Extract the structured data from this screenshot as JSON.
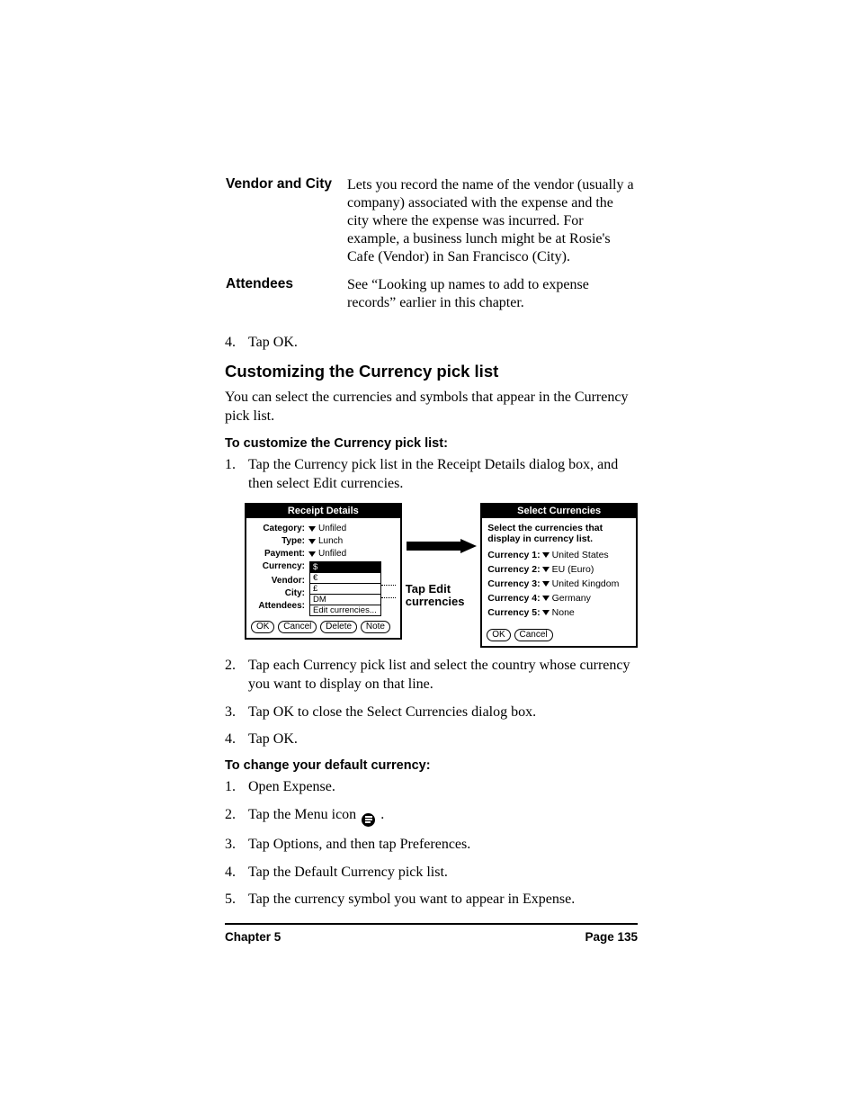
{
  "definitions": [
    {
      "term": "Vendor and City",
      "desc": "Lets you record the name of the vendor (usually a company) associated with the expense and the city where the expense was incurred. For example, a business lunch might be at Rosie's Cafe (Vendor) in San Francisco (City)."
    },
    {
      "term": "Attendees",
      "desc": "See “Looking up names to add to expense records” earlier in this chapter."
    }
  ],
  "pre_step": {
    "n": "4.",
    "t": "Tap OK."
  },
  "section_heading": "Customizing the Currency pick list",
  "section_intro": "You can select the currencies and symbols that appear in the Currency pick list.",
  "proc1_title": "To customize the Currency pick list:",
  "proc1_steps": [
    {
      "n": "1.",
      "t": "Tap the Currency pick list in the Receipt Details dialog box, and then select Edit currencies."
    },
    {
      "n": "2.",
      "t": "Tap each Currency pick list and select the country whose currency you want to display on that line."
    },
    {
      "n": "3.",
      "t": "Tap OK to close the Select Currencies dialog box."
    },
    {
      "n": "4.",
      "t": "Tap OK."
    }
  ],
  "proc2_title": "To change your default currency:",
  "proc2_steps": [
    {
      "n": "1.",
      "t": "Open Expense."
    },
    {
      "n": "2.",
      "t_pre": "Tap the Menu icon ",
      "t_post": " ."
    },
    {
      "n": "3.",
      "t": "Tap Options, and then tap Preferences."
    },
    {
      "n": "4.",
      "t": "Tap the Default Currency pick list."
    },
    {
      "n": "5.",
      "t": "Tap the currency symbol you want to appear in Expense."
    }
  ],
  "fig": {
    "receipt": {
      "title": "Receipt Details",
      "category_label": "Category:",
      "category_value": "Unfiled",
      "type_label": "Type:",
      "type_value": "Lunch",
      "payment_label": "Payment:",
      "payment_value": "Unfiled",
      "currency_label": "Currency:",
      "currency_options": [
        "$",
        "€",
        "£",
        "DM",
        "Edit currencies..."
      ],
      "vendor_label": "Vendor:",
      "city_label": "City:",
      "attendees_label": "Attendees:",
      "buttons": [
        "OK",
        "Cancel",
        "Delete",
        "Note"
      ]
    },
    "callout": "Tap Edit currencies",
    "select": {
      "title": "Select Currencies",
      "intro": "Select the currencies that display in currency list.",
      "rows": [
        {
          "lab": "Currency 1:",
          "val": "United States"
        },
        {
          "lab": "Currency 2:",
          "val": "EU (Euro)"
        },
        {
          "lab": "Currency 3:",
          "val": "United Kingdom"
        },
        {
          "lab": "Currency 4:",
          "val": "Germany"
        },
        {
          "lab": "Currency 5:",
          "val": "None"
        }
      ],
      "buttons": [
        "OK",
        "Cancel"
      ]
    }
  },
  "footer": {
    "left": "Chapter 5",
    "right": "Page 135"
  }
}
